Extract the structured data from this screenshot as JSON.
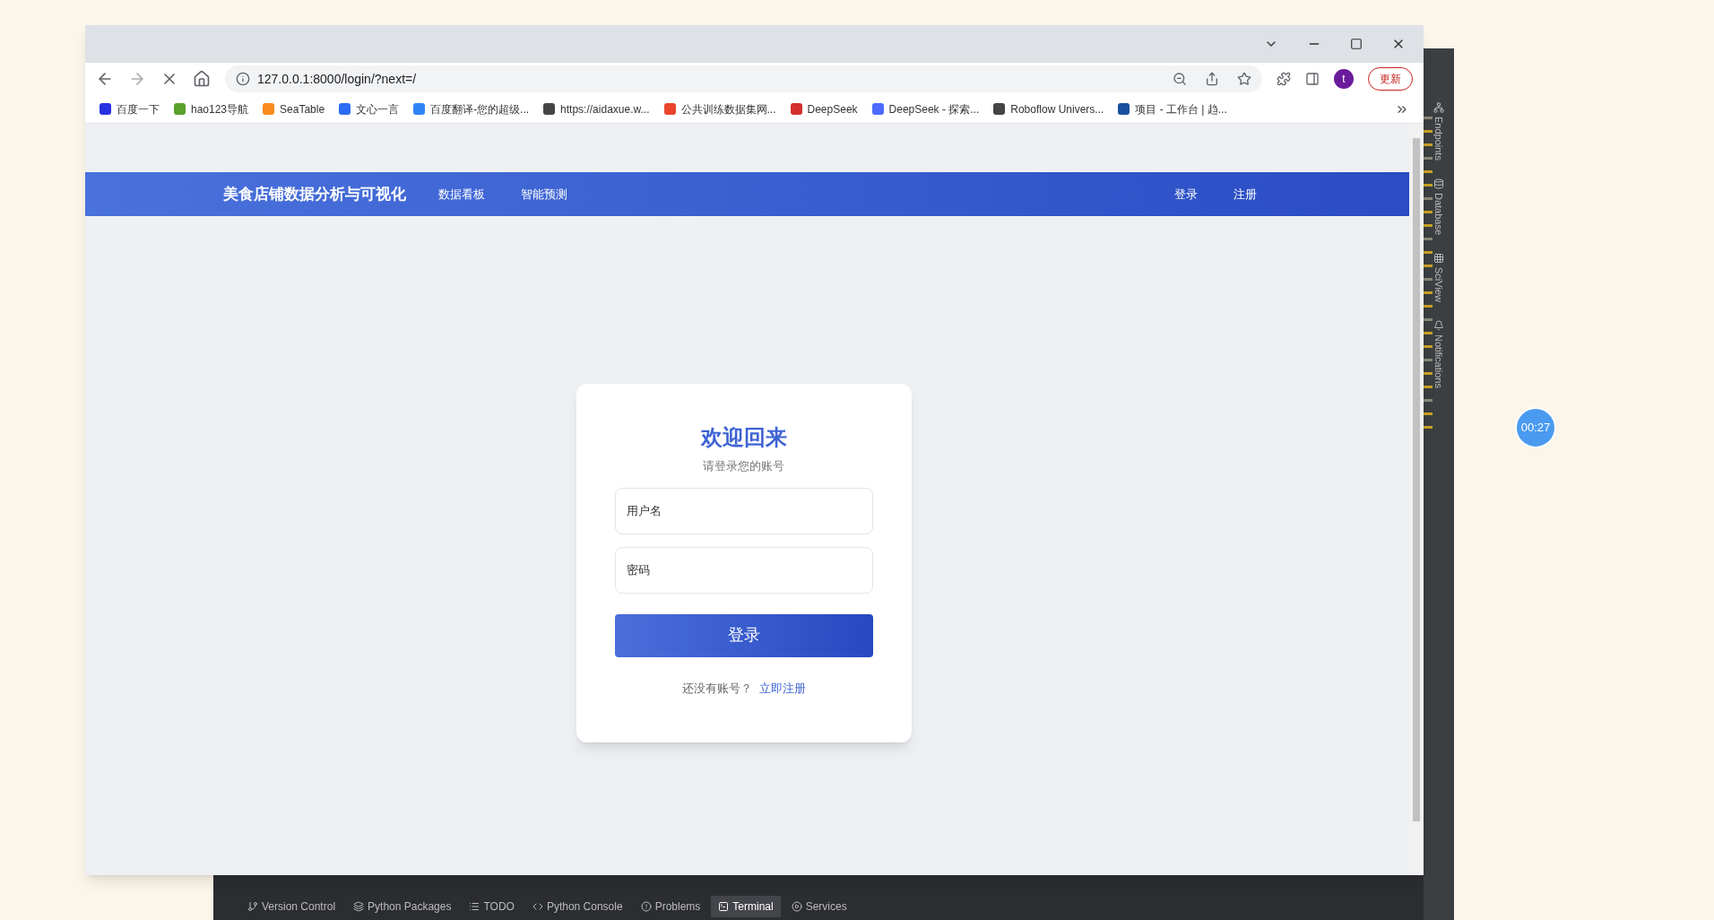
{
  "browser": {
    "address_bar": {
      "url": "127.0.0.1:8000/login/?next=/"
    },
    "profile": {
      "initial": "t"
    },
    "update_button": "更新",
    "bookmarks": [
      {
        "label": "百度一下",
        "color": "#2932e1"
      },
      {
        "label": "hao123导航",
        "color": "#5aa02c"
      },
      {
        "label": "SeaTable",
        "color": "#f98a1d"
      },
      {
        "label": "文心一言",
        "color": "#2a6df4"
      },
      {
        "label": "百度翻译-您的超级...",
        "color": "#2f84f5"
      },
      {
        "label": "https://aidaxue.w...",
        "color": "#444444"
      },
      {
        "label": "公共训练数据集网...",
        "color": "#e8452c"
      },
      {
        "label": "DeepSeek",
        "color": "#d32f2f"
      },
      {
        "label": "DeepSeek - 探索...",
        "color": "#4d6bfe"
      },
      {
        "label": "Roboflow Univers...",
        "color": "#444444"
      },
      {
        "label": "项目 - 工作台 | 趋...",
        "color": "#1a4fa0"
      }
    ]
  },
  "page": {
    "navbar": {
      "brand": "美食店铺数据分析与可视化",
      "links": [
        {
          "label": "数据看板"
        },
        {
          "label": "智能预测"
        }
      ],
      "account_links": [
        {
          "label": "登录"
        },
        {
          "label": "注册"
        }
      ]
    },
    "login_card": {
      "title": "欢迎回来",
      "subtitle": "请登录您的账号",
      "fields": [
        {
          "placeholder": "用户名"
        },
        {
          "placeholder": "密码"
        }
      ],
      "submit": "登录",
      "footer_prompt": "还没有账号？",
      "register_link": "立即注册"
    }
  },
  "ide": {
    "side_tabs": [
      {
        "label": "Endpoints"
      },
      {
        "label": "Database"
      },
      {
        "label": "SciView"
      },
      {
        "label": "Notifications"
      }
    ],
    "tool_tabs": [
      {
        "label": "Version Control",
        "selected": false
      },
      {
        "label": "Python Packages",
        "selected": false
      },
      {
        "label": "TODO",
        "selected": false
      },
      {
        "label": "Python Console",
        "selected": false
      },
      {
        "label": "Problems",
        "selected": false
      },
      {
        "label": "Terminal",
        "selected": true
      },
      {
        "label": "Services",
        "selected": false
      }
    ]
  },
  "recorder": {
    "timer": "00:27"
  }
}
